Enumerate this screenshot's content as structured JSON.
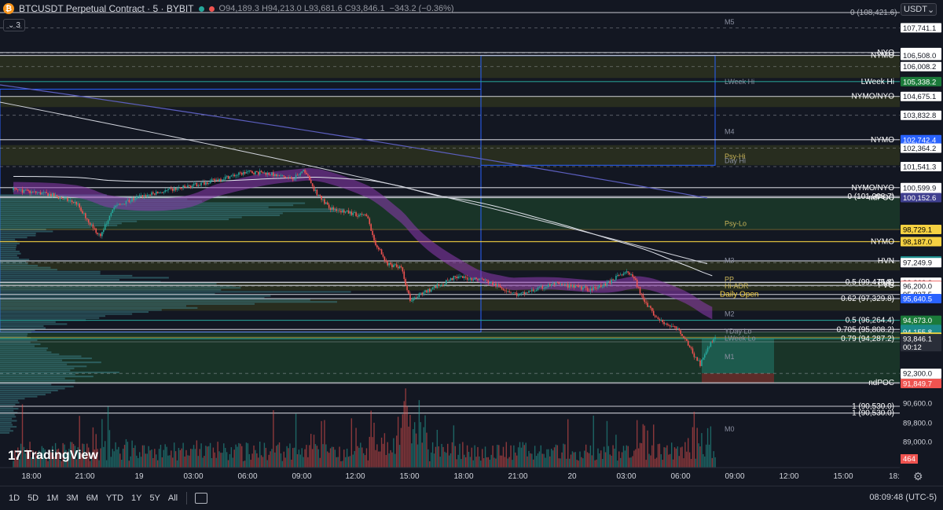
{
  "header": {
    "symbol": "BTCUSDT Perpetual Contract · 5 · BYBIT",
    "open_label": "O",
    "open": "94,189.3",
    "high_label": "H",
    "high": "94,213.0",
    "low_label": "L",
    "low": "93,681.6",
    "close_label": "C",
    "close": "93,846.1",
    "change": "−343.2 (−0.36%)",
    "indicator_count": "3",
    "currency": "USDT"
  },
  "brand": {
    "name": "TradingView"
  },
  "bottom_bar": {
    "timeframes": [
      "1D",
      "5D",
      "1M",
      "3M",
      "6M",
      "YTD",
      "1Y",
      "5Y",
      "All"
    ],
    "clock": "08:09:48 (UTC-5)"
  },
  "colors": {
    "background": "#131722",
    "up": "#26a69a",
    "down": "#ef5350",
    "white_level": "#e0e3eb",
    "zone_green": "#1f4d2e",
    "zone_olive": "#3a3f1e",
    "profile": "#3d7f86",
    "ribbon": "#8e3bb0"
  },
  "chart_data": {
    "type": "candlestick",
    "symbol": "BTCUSDT",
    "timeframe_minutes": 5,
    "ylim": [
      89400,
      108600
    ],
    "time_range": [
      "17:10",
      "18:45"
    ],
    "x_ticks": [
      "18:00",
      "21:00",
      "19",
      "03:00",
      "06:00",
      "09:00",
      "12:00",
      "15:00",
      "18:00",
      "21:00",
      "20",
      "03:00",
      "06:00",
      "09:00",
      "12:00",
      "15:00",
      "18:"
    ],
    "y_ticks": [
      "90,600.0",
      "89,800.0",
      "89,000.0",
      "88,200.0"
    ],
    "price_path": [
      [
        "17:00",
        100500
      ],
      [
        "19:00",
        100300
      ],
      [
        "20:30",
        99900
      ],
      [
        "21:20",
        98900
      ],
      [
        "21:50",
        98400
      ],
      [
        "22:30",
        99700
      ],
      [
        "00:00",
        100200
      ],
      [
        "03:00",
        100700
      ],
      [
        "05:00",
        101100
      ],
      [
        "06:00",
        101300
      ],
      [
        "07:00",
        101250
      ],
      [
        "08:30",
        101000
      ],
      [
        "09:10",
        101350
      ],
      [
        "09:40",
        100500
      ],
      [
        "10:30",
        99700
      ],
      [
        "11:30",
        99500
      ],
      [
        "12:40",
        99300
      ],
      [
        "13:00",
        98200
      ],
      [
        "13:45",
        97200
      ],
      [
        "14:30",
        97000
      ],
      [
        "15:00",
        95600
      ],
      [
        "16:30",
        96200
      ],
      [
        "17:30",
        96600
      ],
      [
        "19:00",
        96500
      ],
      [
        "21:00",
        95800
      ],
      [
        "23:00",
        96300
      ],
      [
        "01:00",
        96050
      ],
      [
        "02:00",
        96350
      ],
      [
        "03:00",
        96900
      ],
      [
        "03:30",
        96400
      ],
      [
        "04:00",
        95500
      ],
      [
        "04:40",
        94800
      ],
      [
        "05:00",
        94600
      ],
      [
        "05:45",
        94300
      ],
      [
        "06:15",
        93900
      ],
      [
        "06:40",
        93200
      ],
      [
        "07:05",
        92700
      ],
      [
        "07:30",
        93500
      ],
      [
        "07:55",
        93846
      ]
    ],
    "last_price": {
      "value": "93,846.1",
      "countdown": "00:12"
    },
    "levels": [
      {
        "price": 107741.1,
        "label": "",
        "axis": "107,741.1"
      },
      {
        "price": 106636.9,
        "label": "NYO",
        "axis": "106,636.9"
      },
      {
        "price": 106617.3,
        "label": "",
        "axis": "106,617.3"
      },
      {
        "price": 106508.0,
        "label": "NYMO",
        "axis": "106,508.0"
      },
      {
        "price": 106008.2,
        "label": "",
        "axis": "106,008.2"
      },
      {
        "price": 105338.2,
        "label": "LWeek Hi",
        "axis": "105,338.2",
        "axis_color": "#1b7a3a"
      },
      {
        "price": 104675.1,
        "label": "NYMO/NYO",
        "axis": "104,675.1"
      },
      {
        "price": 103832.8,
        "label": "",
        "axis": "103,832.8"
      },
      {
        "price": 102742.4,
        "label": "NYMO",
        "axis": "102,742.4",
        "axis_color": "#2962ff"
      },
      {
        "price": 102364.2,
        "label": "",
        "axis": "102,364.2"
      },
      {
        "price": 101541.3,
        "label": "",
        "axis": "101,541.3"
      },
      {
        "price": 100599.9,
        "label": "NYMO/NYO",
        "axis": "100,599.9"
      },
      {
        "price": 100202.9,
        "label": "0 (101,998.7)",
        "axis": "100,202.9"
      },
      {
        "price": 100152.6,
        "label": "ndPOC",
        "axis": "100,152.6",
        "axis_color": "#3f3f8f"
      },
      {
        "price": 98729.1,
        "label": "",
        "axis": "98,729.1",
        "axis_color": "#f5d142"
      },
      {
        "price": 98187.0,
        "label": "NYMO",
        "axis": "98,187.0",
        "axis_color": "#f5d142"
      },
      {
        "price": 97327.3,
        "label": "HVN",
        "axis": "97,327.3",
        "axis_color": "#1c8a8a"
      },
      {
        "price": 97249.9,
        "label": "",
        "axis": "97,249.9"
      },
      {
        "price": 96371.1,
        "label": "0.5 (99,475.8)",
        "axis": "96,371.1"
      },
      {
        "price": 96366.0,
        "label": "FVG",
        "axis": "96,366.0"
      },
      {
        "price": 96229.9,
        "label": "FVG",
        "axis": "96,229.9",
        "axis_color": "#ef5350"
      },
      {
        "price": 96200.0,
        "label": "",
        "axis": "96,200.0"
      },
      {
        "price": 95827.5,
        "label": "Daily Open",
        "axis": "95,827.5"
      },
      {
        "price": 95640.5,
        "label": "0.62 (97,329.8)",
        "axis": "95,640.5",
        "axis_color": "#2962ff"
      },
      {
        "price": 94673.0,
        "label": "0.5 (96,264.4)",
        "axis": "94,673.0",
        "axis_color": "#1b7a3a"
      },
      {
        "price": 94263.1,
        "label": "0.705 (95,808.2)",
        "axis": "94,263.1",
        "axis_color": "#1c8a8a"
      },
      {
        "price": 94155.8,
        "label": "",
        "axis": "94,155.8",
        "axis_color": "#1c8a8a"
      },
      {
        "price": 93916.1,
        "label": "",
        "axis": "93,916.1",
        "axis_color": "#f5d142"
      },
      {
        "price": 93888.0,
        "label": "",
        "axis": "93,888.0",
        "axis_color": "#f5d142"
      },
      {
        "price": 93853.2,
        "label": "0.79 (94,287.2)",
        "axis": "93,853.2",
        "axis_color": "#1b7a3a"
      },
      {
        "price": 93711.1,
        "label": "",
        "axis": "93,711.1",
        "axis_color": "#ef5350"
      },
      {
        "price": 92300.0,
        "label": "",
        "axis": "92,300.0"
      },
      {
        "price": 91881.5,
        "label": "ndPOC",
        "axis": "91,881.5"
      },
      {
        "price": 91849.7,
        "label": "",
        "axis": "91,849.7",
        "axis_color": "#ef5350"
      },
      {
        "price": 90530.0,
        "label": "1 (90,530.0)",
        "axis": ""
      }
    ],
    "top_fib_label": "0 (108,421.6)",
    "zone_labels": [
      "M5",
      "LWeek Hi",
      "M4",
      "Psy-Hi",
      "Day Hi",
      "Psy-Lo",
      "M3",
      "PP",
      "Hi-ADR",
      "M2",
      "YDay Lo",
      "LWeek Lo",
      "M1",
      "M0"
    ],
    "volume_badge": "464"
  }
}
